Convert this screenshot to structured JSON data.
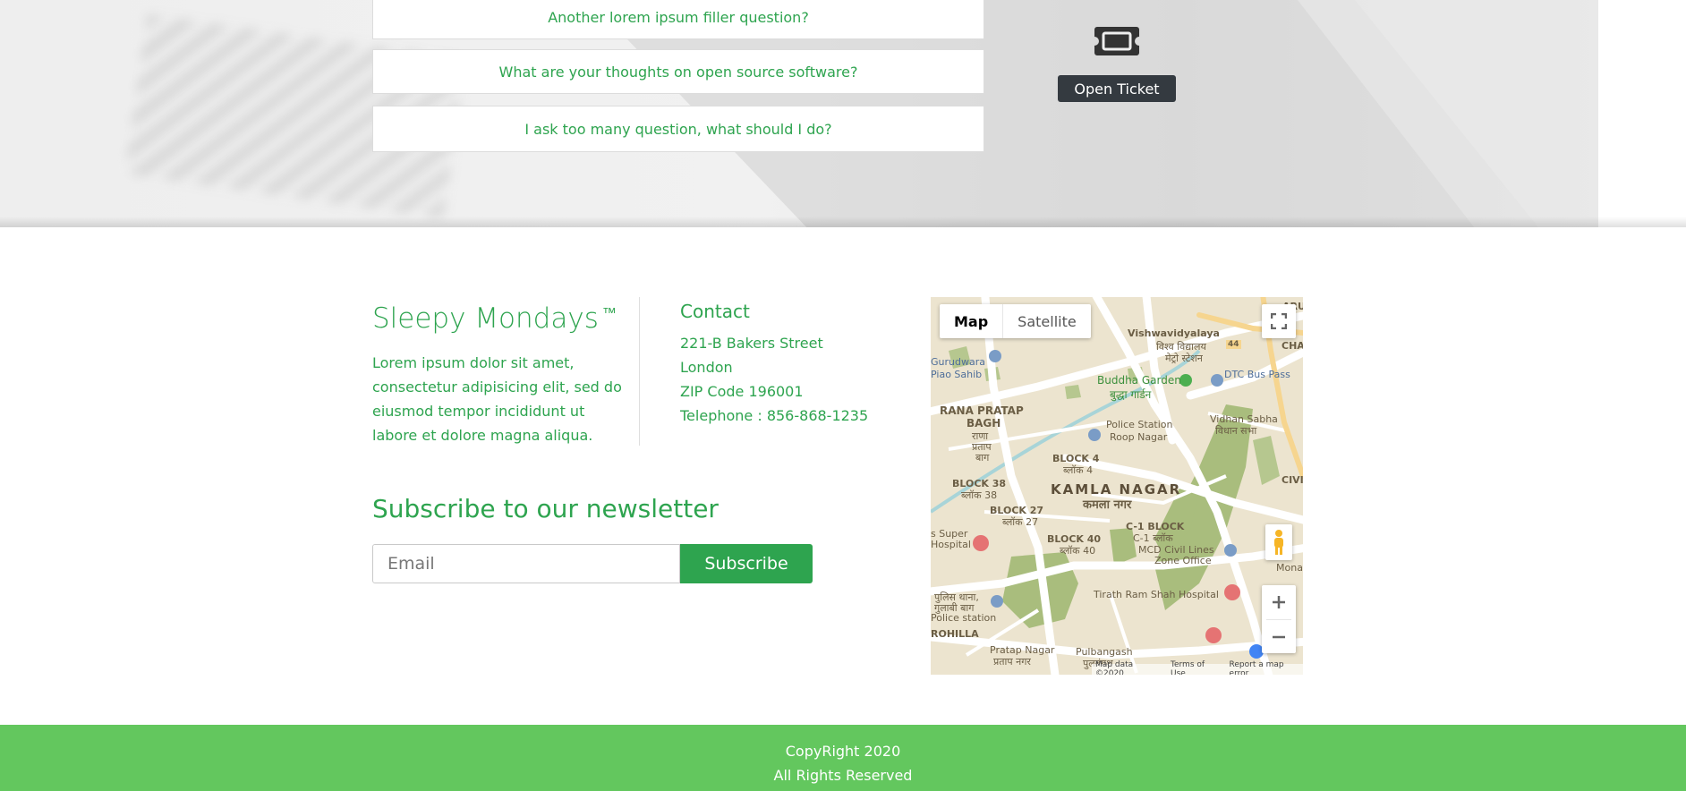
{
  "faq": {
    "items": [
      "Another lorem ipsum filler question?",
      "What are your thoughts on open source software?",
      "I ask too many question, what should I do?"
    ]
  },
  "ticket": {
    "icon": "ticket-icon",
    "button_label": "Open Ticket"
  },
  "brand": {
    "title": "Sleepy Mondays",
    "trademark": "™",
    "text": "Lorem ipsum dolor sit amet, consectetur adipisicing elit, sed do eiusmod tempor incididunt ut labore et dolore magna aliqua."
  },
  "contact": {
    "title": "Contact",
    "lines": [
      "221-B Bakers Street",
      "London",
      "ZIP Code 196001",
      "Telephone : 856-868-1235"
    ]
  },
  "newsletter": {
    "title": "Subscribe to our newsletter",
    "email_placeholder": "Email",
    "email_value": "",
    "button_label": "Subscribe"
  },
  "map": {
    "type_map": "Map",
    "type_satellite": "Satellite",
    "labels": {
      "gurudwara": "Gurudwara",
      "piao_sahib": "Piao Sahib",
      "vishwavidyalaya": "Vishwavidyalaya",
      "vishwavidyalaya_hi": "विश्व विद्यालय",
      "metro_station_hi": "मेट्रो स्टेशन",
      "route_44": "44",
      "arun": "ARUN",
      "cha": "CHA",
      "buddha_garden": "Buddha Garden",
      "buddha_garden_hi": "बुद्धा गार्डन",
      "dtc_bus_pass": "DTC Bus Pass",
      "rana_pratap_bagh": "RANA PRATAP",
      "bagh": "BAGH",
      "rana_hi": "राणा",
      "pratap_hi": "प्रताप",
      "bagh_hi": "बाग",
      "police_station": "Police Station",
      "roop_nagar": "Roop Nagar",
      "vidhan_sabha": "Vidhan Sabha",
      "vidhan_sabha_hi": "विधान सभा",
      "block4": "BLOCK 4",
      "block4_hi": "ब्लॉक 4",
      "block38": "BLOCK 38",
      "block38_hi": "ब्लॉक 38",
      "kamla_nagar": "KAMLA NAGAR",
      "kamla_nagar_hi": "कमला नगर",
      "civil_li": "CIVIL LI",
      "block27": "BLOCK 27",
      "block27_hi": "ब्लॉक 27",
      "c1_block": "C-1 BLOCK",
      "c1_block_hi": "C-1 ब्लॉक",
      "s_super": "s Super",
      "hospital": "Hospital",
      "block40": "BLOCK 40",
      "block40_hi": "ब्लॉक 40",
      "mcd_civil_lines": "MCD Civil Lines",
      "zone_office": "Zone Office",
      "mona": "Mona",
      "tirath_ram": "Tirath Ram Shah Hospital",
      "rohilla": "ROHILLA",
      "pratap_nagar": "Pratap Nagar",
      "pratap_nagar_hi": "प्रताप नगर",
      "pulbangash": "Pulbangash",
      "pulbangash_hi": "पुलबंगश",
      "police_hi": "पुलिस थाना,",
      "gulabi_hi": "गुलाबी बाग",
      "police_station2": "Police station"
    },
    "footer": [
      "Map data ©2020",
      "Terms of Use",
      "Report a map error"
    ]
  },
  "copyright": {
    "line1": "CopyRight 2020",
    "line2": "All Rights Reserved"
  },
  "colors": {
    "accent": "#2ea44f",
    "footer_bar": "#63c75e",
    "dark_button": "#343a40"
  }
}
